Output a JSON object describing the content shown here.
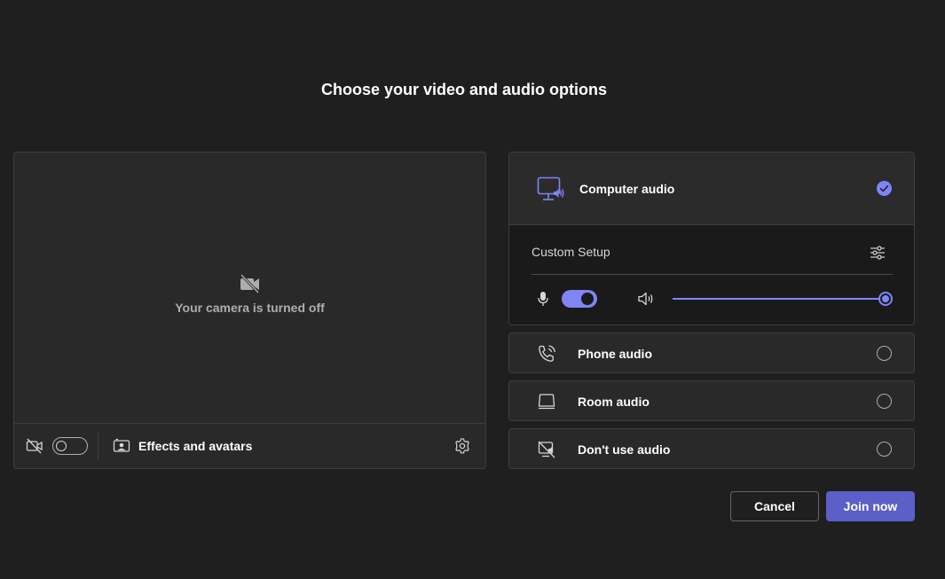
{
  "page": {
    "title": "Choose your video and audio options"
  },
  "video": {
    "camera_off_text": "Your camera is turned off",
    "camera_toggle": "off",
    "effects_label": "Effects and avatars"
  },
  "audio": {
    "computer": {
      "label": "Computer audio",
      "selected": true
    },
    "custom_setup_label": "Custom Setup",
    "mic_toggle": "on",
    "volume_level": 1.0,
    "options": [
      {
        "label": "Phone audio",
        "icon": "phone-audio-icon"
      },
      {
        "label": "Room audio",
        "icon": "room-audio-icon"
      },
      {
        "label": "Don't use audio",
        "icon": "no-audio-icon"
      }
    ]
  },
  "actions": {
    "cancel_label": "Cancel",
    "join_label": "Join now"
  },
  "colors": {
    "accent": "#7f85f5",
    "primary_button": "#5b5fc7",
    "background": "#1f1f1f"
  }
}
